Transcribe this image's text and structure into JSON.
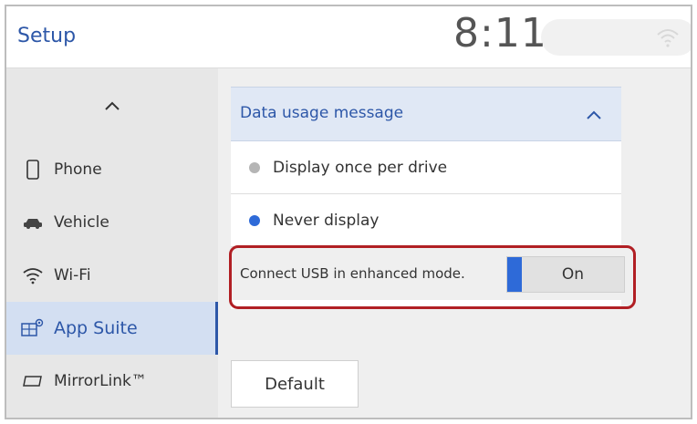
{
  "header": {
    "title": "Setup",
    "clock": "8:11",
    "wifi_icon": "wifi-signal-icon"
  },
  "sidebar": {
    "scroll_up_icon": "chevron-up-icon",
    "items": [
      {
        "label": "Phone",
        "icon": "phone-icon",
        "active": false
      },
      {
        "label": "Vehicle",
        "icon": "car-icon",
        "active": false
      },
      {
        "label": "Wi-Fi",
        "icon": "wifi-icon",
        "active": false
      },
      {
        "label": "App Suite",
        "icon": "app-suite-icon",
        "active": true
      },
      {
        "label": "MirrorLink™",
        "icon": "mirrorlink-icon",
        "active": false
      }
    ]
  },
  "main": {
    "dropdown": {
      "title": "Data usage message",
      "expanded": true,
      "options": [
        {
          "label": "Display once per drive",
          "selected": false
        },
        {
          "label": "Never display",
          "selected": true
        }
      ]
    },
    "usb_setting": {
      "label": "Connect USB in enhanced mode.",
      "toggle_label": "On",
      "is_on": true
    },
    "default_button": "Default"
  },
  "colors": {
    "accent": "#2d57a8",
    "radio_on": "#2e6ad8",
    "highlight": "#b11f24",
    "sidebar_bg": "#e7e7e7",
    "active_bg": "#d3dff2"
  }
}
